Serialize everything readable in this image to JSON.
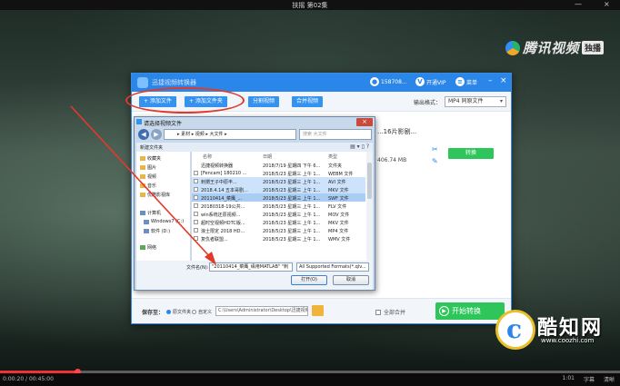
{
  "player": {
    "title": "扶摇 第02集",
    "logo_text": "腾讯视频",
    "logo_tag": "独播",
    "time": "0:00:20 / 00:45:00",
    "controls_right": [
      "1:01",
      "字幕",
      "清晰"
    ],
    "progress_fraction": 0.125,
    "win_buttons": [
      "—",
      "×"
    ]
  },
  "app": {
    "title": "迅捷视频转换器",
    "user_id": "158708...",
    "vip_label": "开通VIP",
    "menu_label": "菜单",
    "toolbar": {
      "add_file": "+ 添加文件",
      "add_folder": "+ 添加文件夹",
      "split_video": "分割视频",
      "merge_video": "合并视频",
      "output_format_label": "输出格式：",
      "output_format_value": "MP4 同原文件"
    },
    "file_card": {
      "name": "...16片影剧...",
      "size": "406.74 MB",
      "action": "转换"
    },
    "footer": {
      "save_to_label": "保存至：",
      "radio_original": "原文件夹",
      "radio_custom": "自定义",
      "path": "C:\\Users\\Administrator\\Desktop\\迅捷视频转换器",
      "merge_label": "全部合并",
      "convert_label": "开始转换"
    }
  },
  "dialog": {
    "title": "请选择视频文件",
    "address": "▸ 素材 ▸ 视频 ▸ 大文件 ▸",
    "search_placeholder": "搜索 大文件",
    "new_folder": "新建文件夹",
    "tree": [
      "收藏夹",
      "图片",
      "视频",
      "音乐",
      "优酷影视库",
      "计算机",
      "Windows7 (C:)",
      "软件 (D:)",
      "网络"
    ],
    "columns": [
      "名称",
      "日期",
      "类型"
    ],
    "rows": [
      {
        "name": "迅捷视频转换器",
        "date": "2018/7/19 星期四 下午 6...",
        "type": "文件夹"
      },
      {
        "name": "[Fencam] 180210 ...",
        "date": "2018/5/23 星期三 上午 1...",
        "type": "WEBM 文件"
      },
      {
        "name": "刺猬王子中原丰...",
        "date": "2018/5/23 星期三 上午 1...",
        "type": "AVI 文件"
      },
      {
        "name": "2018.4.14 五本哥剧...",
        "date": "2018/5/23 星期三 上午 1...",
        "type": "MKV 文件"
      },
      {
        "name": "20110414_菜鹰_...",
        "date": "2018/5/23 星期三 上午 1...",
        "type": "SWF 文件"
      },
      {
        "name": "20180318-19公共...",
        "date": "2018/5/23 星期三 上午 1...",
        "type": "FLV 文件"
      },
      {
        "name": "win系统还原视频...",
        "date": "2018/5/23 星期三 上午 1...",
        "type": "MOV 文件"
      },
      {
        "name": "超时空视频HDTC版...",
        "date": "2018/5/23 星期三 上午 1...",
        "type": "MKV 文件"
      },
      {
        "name": "浪士限定 2018 HD...",
        "date": "2018/5/23 星期三 上午 1...",
        "type": "MP4 文件"
      },
      {
        "name": "复仇者联盟...",
        "date": "2018/5/23 星期三 上午 1...",
        "type": "WMV 文件"
      }
    ],
    "filename_label": "文件名(N):",
    "filename_value": "\"20110414_菜鹰_缘用MATLAB\" \"刺",
    "filetype_value": "All Supported Formats(*.qlv...",
    "open_button": "打开(O)",
    "cancel_button": "取消"
  },
  "watermark": {
    "text": "酷知网",
    "url": "www.coozhi.com"
  }
}
